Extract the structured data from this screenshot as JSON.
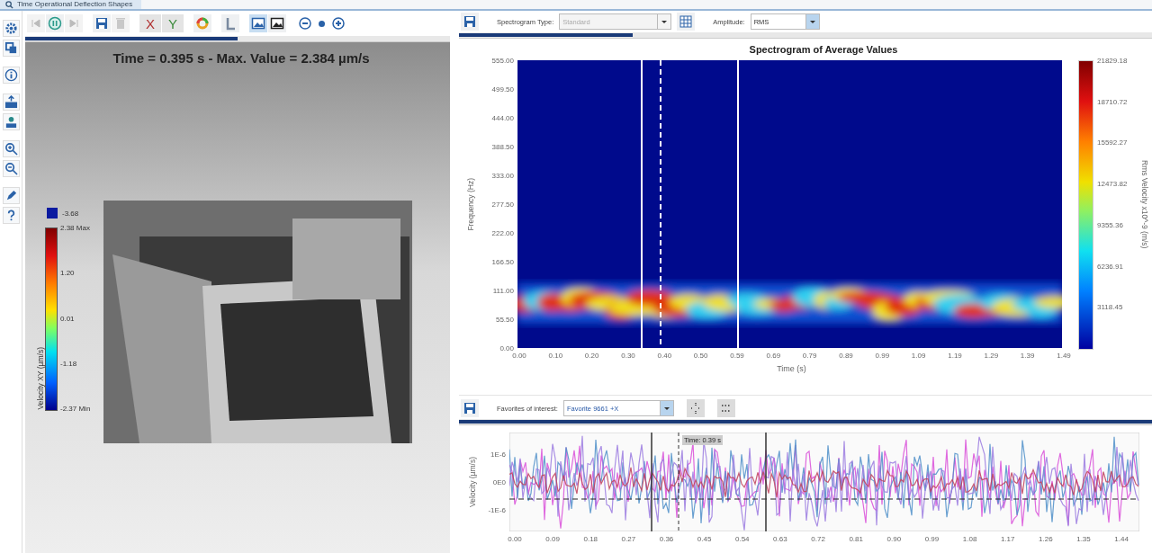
{
  "tab": {
    "title": "Time Operational Deflection Shapes"
  },
  "left_toolbar": {
    "axis_buttons": [
      {
        "label": "X"
      },
      {
        "label": "Y"
      }
    ],
    "view_buttons": [
      {
        "selected": true
      },
      {
        "selected": false
      }
    ],
    "progress": {
      "level": 0.5
    }
  },
  "viewer": {
    "title": "Time = 0.395 s - Max. Value = 2.384 µm/s",
    "legend": {
      "below_range": "-3.68",
      "ticks": [
        "2.38 Max",
        "1.20",
        "0.01",
        "-1.18",
        "-2.37 Min"
      ],
      "label": "Velocity XY (µm/s)"
    }
  },
  "spectrogram_panel": {
    "type_label": "Spectrogram Type:",
    "type_value": "Standard",
    "type_disabled": true,
    "amplitude_label": "Amplitude:",
    "amplitude_value": "RMS",
    "progress": {
      "level": 0.25
    },
    "title": "Spectrogram of Average Values",
    "ylabel": "Frequency (Hz)",
    "yticks": [
      "555.00",
      "499.50",
      "444.00",
      "388.50",
      "333.00",
      "277.50",
      "222.00",
      "166.50",
      "111.00",
      "55.50",
      "0.00"
    ],
    "xticks": [
      "0.00",
      "0.10",
      "0.20",
      "0.30",
      "0.40",
      "0.50",
      "0.59",
      "0.69",
      "0.79",
      "0.89",
      "0.99",
      "1.09",
      "1.19",
      "1.29",
      "1.39",
      "1.49"
    ],
    "xlabel": "Time (s)",
    "colorbar_ticks": [
      "21829.18",
      "18710.72",
      "15592.27",
      "12473.82",
      "9355.36",
      "6236.91",
      "3118.45"
    ],
    "colorbar_label": "Rms Velocity x10^-9 (m/s)"
  },
  "signal_panel": {
    "favorites_label": "Favorites of interest:",
    "favorites_value": "Favorite 9661 +X",
    "progress": {
      "level": 1
    },
    "ylabel": "Velocity (µm/s)",
    "yticks": [
      "1E-6",
      "0E0",
      "-1E-6"
    ],
    "xticks": [
      "0.00",
      "0.09",
      "0.18",
      "0.27",
      "0.36",
      "0.45",
      "0.54",
      "0.63",
      "0.72",
      "0.81",
      "0.90",
      "0.99",
      "1.08",
      "1.17",
      "1.26",
      "1.35",
      "1.44"
    ],
    "cursor_label": "Time: 0.39 s"
  }
}
